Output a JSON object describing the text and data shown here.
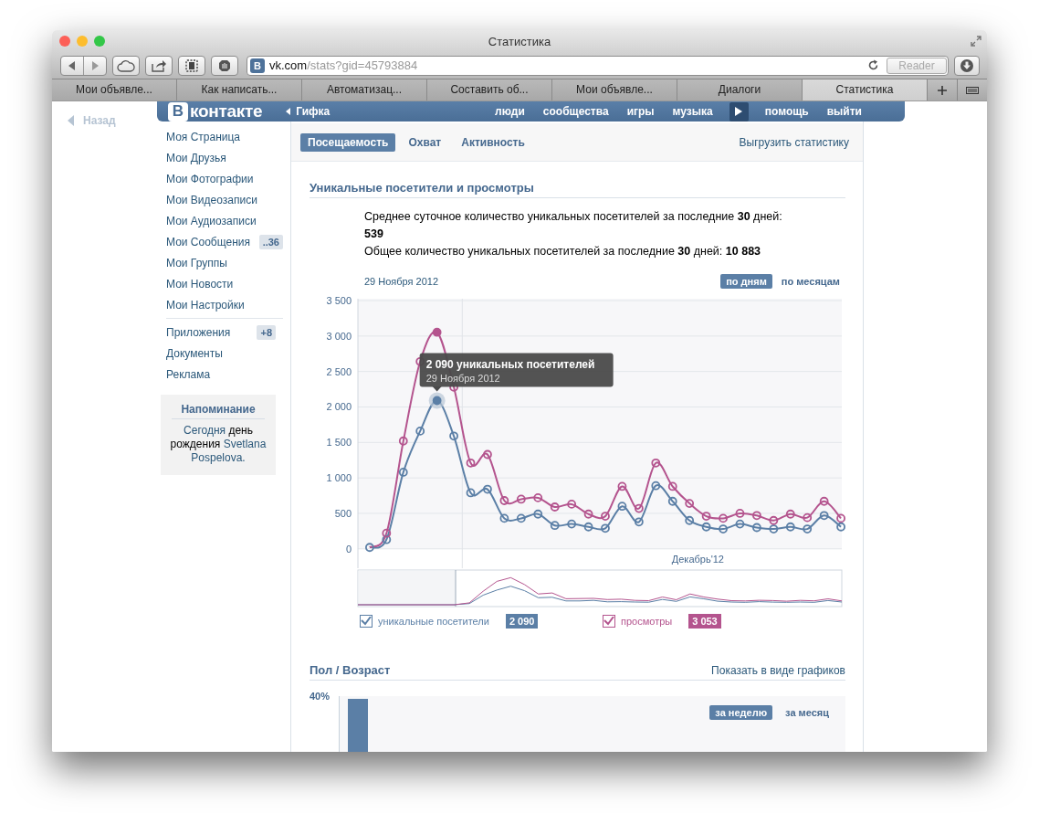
{
  "window": {
    "title": "Статистика"
  },
  "toolbar": {
    "favicon": "B",
    "address_host": "vk.com",
    "address_path": "/stats?gid=45793884",
    "reader": {
      "label": "Reader",
      "disabled": true
    }
  },
  "tabs": [
    {
      "label": "Мои объявле...",
      "selected": false
    },
    {
      "label": "Как написать...",
      "selected": false
    },
    {
      "label": "Автоматизац...",
      "selected": false
    },
    {
      "label": "Составить об...",
      "selected": false
    },
    {
      "label": "Мои объявле...",
      "selected": false
    },
    {
      "label": "Диалоги",
      "selected": false
    },
    {
      "label": "Статистика",
      "selected": true
    }
  ],
  "page": {
    "back_link": "Назад",
    "header": {
      "logo_badge": "В",
      "logo_text": "контакте",
      "back": "Гифка",
      "nav": [
        {
          "kind": "link",
          "label": "люди"
        },
        {
          "kind": "link",
          "label": "сообщества"
        },
        {
          "kind": "link",
          "label": "игры"
        },
        {
          "kind": "link",
          "label": "музыка"
        },
        {
          "kind": "more"
        },
        {
          "kind": "link",
          "label": "помощь"
        },
        {
          "kind": "link",
          "label": "выйти"
        }
      ]
    },
    "sidebar": {
      "groups": [
        [
          {
            "label": "Моя Страница"
          },
          {
            "label": "Мои Друзья"
          },
          {
            "label": "Мои Фотографии"
          },
          {
            "label": "Мои Видеозаписи"
          },
          {
            "label": "Мои Аудиозаписи"
          },
          {
            "label": "Мои Сообщения",
            "badge": "..36"
          },
          {
            "label": "Мои Группы"
          },
          {
            "label": "Мои Новости"
          },
          {
            "label": "Мои Настройки"
          }
        ],
        [
          {
            "label": "Приложения",
            "badge": "+8"
          },
          {
            "label": "Документы"
          },
          {
            "label": "Реклама"
          }
        ]
      ],
      "reminder": {
        "title": "Напоминание",
        "prefix": "Сегодня",
        "event": "день рождения",
        "name": "Svetlana Pospelova."
      }
    }
  },
  "stats_tabs": [
    {
      "label": "Посещаемость",
      "selected": true
    },
    {
      "label": "Охват",
      "selected": false
    },
    {
      "label": "Активность",
      "selected": false
    }
  ],
  "export_link": "Выгрузить статистику",
  "visits": {
    "title": "Уникальные посетители и просмотры",
    "average_label": "Среднее суточное количество уникальных посетителей за последние **30** дней:",
    "average_value": "539",
    "total": "Общее количество уникальных посетителей за последние **30** дней: **10 883**",
    "date": "29 Ноября 2012",
    "periods": [
      {
        "label": "по дням",
        "selected": true
      },
      {
        "label": "по месяцам",
        "selected": false
      }
    ],
    "tooltip_date": "29 Ноября 2012",
    "chart_data": {
      "type": "line",
      "grid": true,
      "ylim": [
        0,
        3500
      ],
      "yticks": [
        {
          "value": 0,
          "label": "0"
        },
        {
          "value": 500,
          "label": "500"
        },
        {
          "value": 1000,
          "label": "1 000"
        },
        {
          "value": 1500,
          "label": "1 500"
        },
        {
          "value": 2000,
          "label": "2 000"
        },
        {
          "value": 2500,
          "label": "2 500"
        },
        {
          "value": 3000,
          "label": "3 000"
        },
        {
          "value": 3500,
          "label": "3 500"
        }
      ],
      "series": [
        {
          "color": "#5b7fa6",
          "marker": "o",
          "values": [
            20,
            130,
            1080,
            1660,
            2090,
            1590,
            790,
            840,
            430,
            430,
            490,
            330,
            350,
            310,
            290,
            600,
            380,
            890,
            670,
            400,
            310,
            280,
            350,
            300,
            280,
            310,
            280,
            470,
            310
          ]
        },
        {
          "color": "#b4548e",
          "marker": "o",
          "values": [
            20,
            220,
            1520,
            2640,
            3053,
            2280,
            1210,
            1330,
            680,
            700,
            720,
            590,
            630,
            490,
            460,
            880,
            570,
            1210,
            880,
            640,
            460,
            430,
            500,
            470,
            400,
            490,
            440,
            670,
            430
          ]
        }
      ],
      "annotations": [
        "Декабрь'12"
      ]
    },
    "tooltip": {
      "title": "2 090 уникальных посетителей"
    },
    "legend": [
      {
        "label": "уникальные посетители",
        "checked": true,
        "value": "2 090",
        "color": "#5b7fa6"
      },
      {
        "label": "просмотры",
        "checked": true,
        "value": "3 053",
        "color": "#b4548e"
      }
    ]
  },
  "demographics": {
    "title": "Пол / Возраст",
    "link": "Показать в виде графиков",
    "axis_label": "40%",
    "periods": [
      {
        "label": "за неделю",
        "selected": true
      },
      {
        "label": "за месяц",
        "selected": false
      }
    ]
  }
}
